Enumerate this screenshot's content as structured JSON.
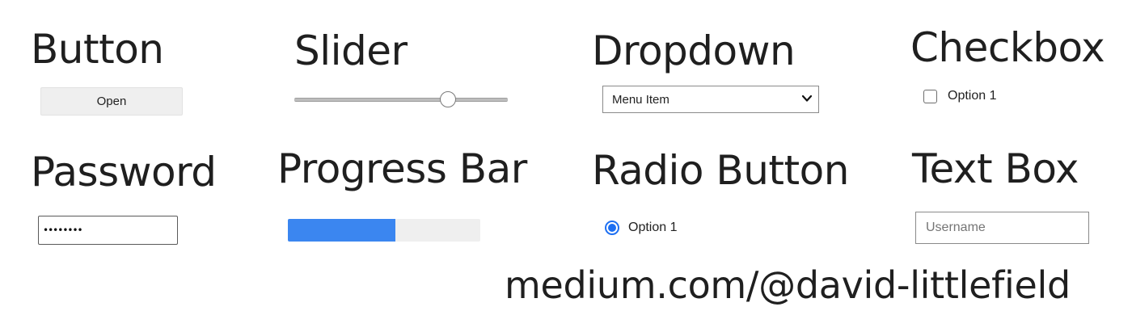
{
  "headings": {
    "button": "Button",
    "slider": "Slider",
    "dropdown": "Dropdown",
    "checkbox": "Checkbox",
    "password": "Password",
    "progress": "Progress Bar",
    "radio": "Radio Button",
    "textbox": "Text Box"
  },
  "button": {
    "label": "Open"
  },
  "slider": {
    "value": 72,
    "min": 0,
    "max": 100
  },
  "dropdown": {
    "selected": "Menu Item"
  },
  "checkbox": {
    "label": "Option 1",
    "checked": false
  },
  "password": {
    "masked_value": "••••••••"
  },
  "progress": {
    "value": 0.56
  },
  "radio": {
    "label": "Option 1",
    "selected": true
  },
  "textbox": {
    "placeholder": "Username"
  },
  "watermark": "medium.com/@david-littlefield",
  "colors": {
    "accent": "#3b86f0",
    "radio_accent": "#1d6ff2",
    "button_bg": "#efefef"
  }
}
